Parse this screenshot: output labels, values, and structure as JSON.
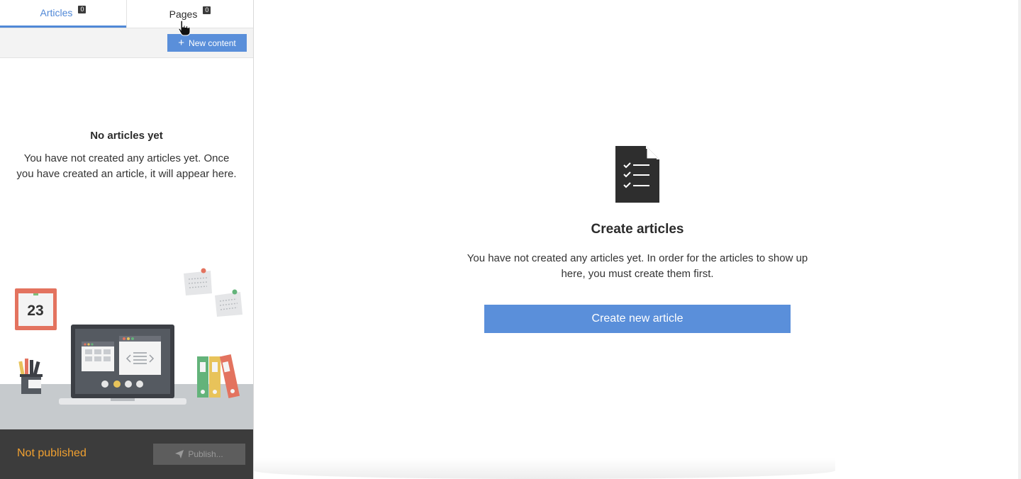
{
  "tabs": [
    {
      "label": "Articles",
      "count": "0",
      "active": true
    },
    {
      "label": "Pages",
      "count": "0",
      "active": false
    }
  ],
  "toolbar": {
    "new_content_label": "New content",
    "new_content_icon": "plus-icon"
  },
  "sidebar_empty": {
    "title": "No articles yet",
    "text": "You have not created any articles yet. Once you have created an article, it will appear here."
  },
  "illustration": {
    "calendar_day": "23"
  },
  "footer": {
    "status": "Not published",
    "publish_label": "Publish...",
    "publish_icon": "paper-plane-icon"
  },
  "main": {
    "icon": "document-checklist-icon",
    "title": "Create articles",
    "text": "You have not created any articles yet. In order for the articles to show up here, you must create them first.",
    "create_label": "Create new article"
  },
  "colors": {
    "accent": "#5a8fda",
    "warning": "#f0a030",
    "footer_bg": "#3c3c3c"
  }
}
